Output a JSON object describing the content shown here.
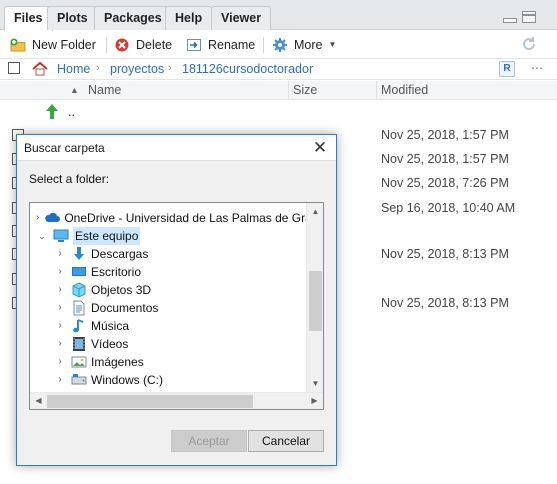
{
  "tabs": [
    {
      "label": "Files",
      "active": true
    },
    {
      "label": "Plots",
      "active": false
    },
    {
      "label": "Packages",
      "active": false
    },
    {
      "label": "Help",
      "active": false
    },
    {
      "label": "Viewer",
      "active": false
    }
  ],
  "toolbar": {
    "new_folder": "New Folder",
    "delete": "Delete",
    "rename": "Rename",
    "more": "More"
  },
  "breadcrumb": [
    "Home",
    "proyectos",
    "181126cursodoctorador"
  ],
  "columns": {
    "name": "Name",
    "size": "Size",
    "modified": "Modified"
  },
  "parent_dir": "..",
  "rows": [
    {
      "name": "...",
      "size": "",
      "modified": "Nov 25, 2018, 1:57 PM"
    },
    {
      "name": "",
      "size": "",
      "modified": "Nov 25, 2018, 1:57 PM"
    },
    {
      "name": "",
      "size": "",
      "modified": "Nov 25, 2018, 7:26 PM"
    },
    {
      "name": "",
      "size": "",
      "modified": "Sep 16, 2018, 10:40 AM"
    },
    {
      "name": "",
      "size": "",
      "modified": "Nov 25, 2018, 8:13 PM"
    },
    {
      "name": "",
      "size": "",
      "modified": ""
    },
    {
      "name": "",
      "size": "",
      "modified": "Nov 25, 2018, 8:13 PM"
    }
  ],
  "dialog": {
    "title": "Buscar carpeta",
    "prompt": "Select a folder:",
    "tree": [
      {
        "label": "OneDrive - Universidad de Las Palmas de Gran C",
        "icon": "cloud-icon",
        "expanded": false,
        "level": 0
      },
      {
        "label": "Este equipo",
        "icon": "computer-icon",
        "expanded": true,
        "level": 0,
        "selected": true
      },
      {
        "label": "Descargas",
        "icon": "download-icon",
        "expanded": false,
        "level": 1
      },
      {
        "label": "Escritorio",
        "icon": "desktop-icon",
        "expanded": false,
        "level": 1
      },
      {
        "label": "Objetos 3D",
        "icon": "cube-icon",
        "expanded": false,
        "level": 1
      },
      {
        "label": "Documentos",
        "icon": "document-icon",
        "expanded": false,
        "level": 1
      },
      {
        "label": "Música",
        "icon": "music-icon",
        "expanded": false,
        "level": 1
      },
      {
        "label": "Vídeos",
        "icon": "video-icon",
        "expanded": false,
        "level": 1
      },
      {
        "label": "Imágenes",
        "icon": "image-icon",
        "expanded": false,
        "level": 1
      },
      {
        "label": "Windows (C:)",
        "icon": "drive-icon",
        "expanded": false,
        "level": 1
      }
    ],
    "accept": "Aceptar",
    "cancel": "Cancelar"
  },
  "colors": {
    "accent": "#2b79d0",
    "link": "#2a6ebb",
    "selection": "#cce8ff"
  }
}
